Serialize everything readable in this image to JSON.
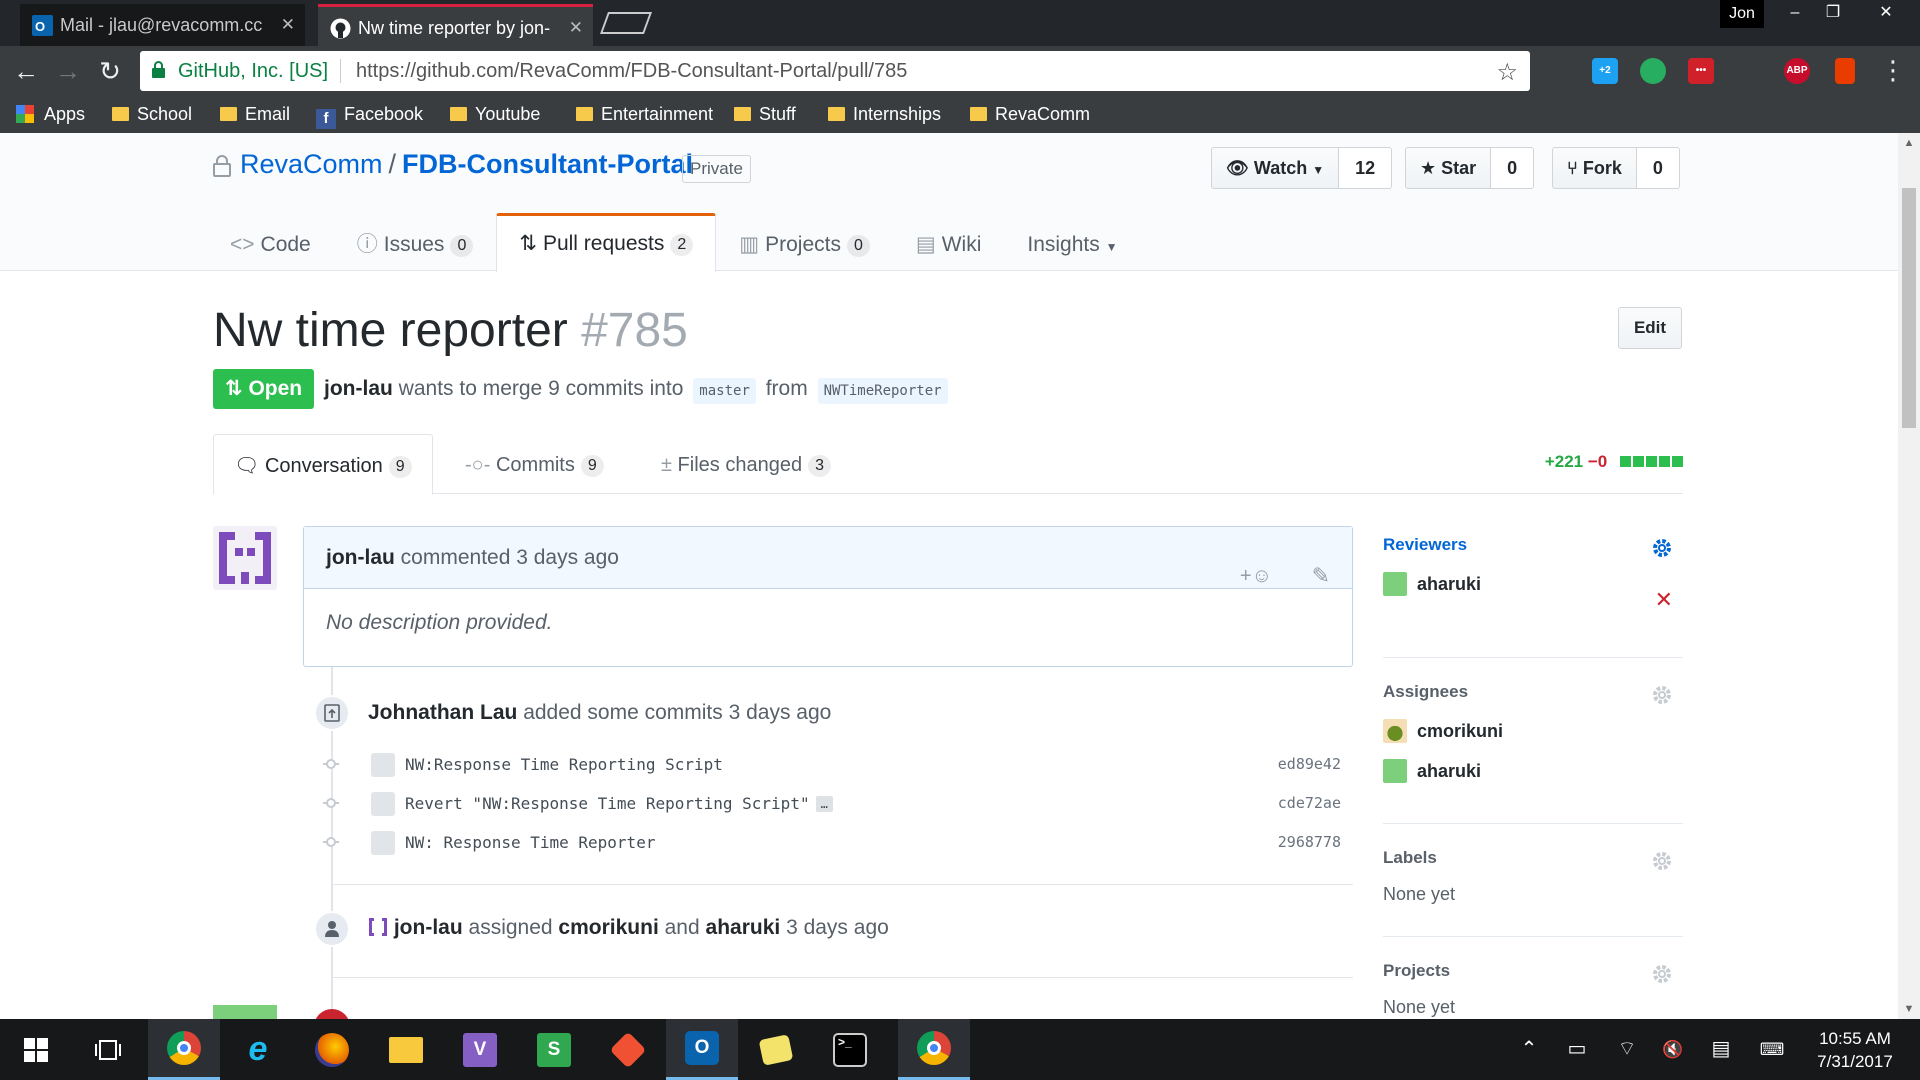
{
  "browser": {
    "tabs": [
      {
        "title": "Mail - jlau@revacomm.cc",
        "active": false
      },
      {
        "title": "Nw time reporter by jon-",
        "active": true
      }
    ],
    "user_chip": "Jon",
    "window_controls": [
      "–",
      "❐",
      "✕"
    ],
    "omnibox": {
      "security_label": "GitHub, Inc. [US]",
      "url": "https://github.com/RevaComm/FDB-Consultant-Portal/pull/785"
    },
    "extensions": [
      {
        "icon": "extension-1-icon",
        "text": "",
        "color": "#3a3d40"
      },
      {
        "icon": "extension-2-icon",
        "text": "+2",
        "color": "#1da1f2"
      },
      {
        "icon": "extension-3-icon",
        "text": "",
        "color": "#27ae60"
      },
      {
        "icon": "extension-4-icon",
        "text": "•••",
        "color": "#d0212b"
      },
      {
        "icon": "extension-5-icon",
        "text": "",
        "color": "#3a3d40"
      },
      {
        "icon": "adblock-plus-icon",
        "text": "ABP",
        "color": "#c70d2c"
      },
      {
        "icon": "office-icon",
        "text": "",
        "color": "#eb3c00"
      }
    ],
    "bookmarks": [
      {
        "label": "Apps",
        "icon": "apps-grid-icon"
      },
      {
        "label": "School",
        "icon": "folder-icon"
      },
      {
        "label": "Email",
        "icon": "folder-icon"
      },
      {
        "label": "Facebook",
        "icon": "facebook-icon"
      },
      {
        "label": "Youtube",
        "icon": "folder-icon"
      },
      {
        "label": "Entertainment",
        "icon": "folder-icon"
      },
      {
        "label": "Stuff",
        "icon": "folder-icon"
      },
      {
        "label": "Internships",
        "icon": "folder-icon"
      },
      {
        "label": "RevaComm",
        "icon": "folder-icon"
      }
    ]
  },
  "repo": {
    "owner": "RevaComm",
    "separator": "/",
    "name": "FDB-Consultant-Portal",
    "visibility": "Private",
    "actions": {
      "watch_label": "Watch",
      "watch_count": "12",
      "star_label": "Star",
      "star_count": "0",
      "fork_label": "Fork",
      "fork_count": "0"
    },
    "nav": [
      {
        "label": "Code",
        "count": "",
        "selected": false,
        "icon": "code-icon"
      },
      {
        "label": "Issues",
        "count": "0",
        "selected": false,
        "icon": "issue-icon"
      },
      {
        "label": "Pull requests",
        "count": "2",
        "selected": true,
        "icon": "pull-request-icon"
      },
      {
        "label": "Projects",
        "count": "0",
        "selected": false,
        "icon": "project-icon"
      },
      {
        "label": "Wiki",
        "count": "",
        "selected": false,
        "icon": "book-icon"
      },
      {
        "label": "Insights",
        "count": "",
        "selected": false,
        "icon": "chevron-down-icon"
      }
    ]
  },
  "pr": {
    "title": "Nw time reporter",
    "number": "#785",
    "edit_label": "Edit",
    "state": "Open",
    "author": "jon-lau",
    "merge_text": "wants to merge 9 commits into",
    "base_branch": "master",
    "from_text": "from",
    "head_branch": "NWTimeReporter",
    "tabs": [
      {
        "label": "Conversation",
        "count": "9",
        "selected": true,
        "icon": "comment-discussion-icon"
      },
      {
        "label": "Commits",
        "count": "9",
        "selected": false,
        "icon": "commit-icon"
      },
      {
        "label": "Files changed",
        "count": "3",
        "selected": false,
        "icon": "diff-icon"
      }
    ],
    "diffstat": {
      "additions": "+221",
      "deletions": "−0",
      "bars": 5
    }
  },
  "comment": {
    "author": "jon-lau",
    "action": "commented 3 days ago",
    "body": "No description provided.",
    "react_label": "+☺"
  },
  "timeline": {
    "commits_event": {
      "actor": "Johnathan Lau",
      "action": "added some commits 3 days ago"
    },
    "commits": [
      {
        "message": "NW:Response Time Reporting Script",
        "sha": "ed89e42",
        "has_more": false
      },
      {
        "message": "Revert \"NW:Response Time Reporting Script\"",
        "sha": "cde72ae",
        "has_more": true
      },
      {
        "message": "NW: Response Time Reporter",
        "sha": "2968778",
        "has_more": false
      }
    ],
    "ellipsis_label": "…",
    "assign_event": {
      "actor": "jon-lau",
      "verb": "assigned",
      "user1": "cmorikuni",
      "conj": "and",
      "user2": "aharuki",
      "time": "3 days ago"
    }
  },
  "sidebar": {
    "reviewers": {
      "heading": "Reviewers",
      "items": [
        "aharuki"
      ]
    },
    "assignees": {
      "heading": "Assignees",
      "items": [
        "cmorikuni",
        "aharuki"
      ]
    },
    "labels": {
      "heading": "Labels",
      "empty": "None yet"
    },
    "projects": {
      "heading": "Projects",
      "empty": "None yet"
    }
  },
  "taskbar": {
    "apps": [
      {
        "icon": "windows-start-icon",
        "running": false
      },
      {
        "icon": "task-view-icon",
        "running": false
      },
      {
        "icon": "chrome-icon",
        "running": true
      },
      {
        "icon": "internet-explorer-icon",
        "running": false
      },
      {
        "icon": "firefox-icon",
        "running": false
      },
      {
        "icon": "file-explorer-icon",
        "running": false
      },
      {
        "icon": "visual-studio-icon",
        "running": false
      },
      {
        "icon": "sourcetree-icon",
        "running": false
      },
      {
        "icon": "git-icon",
        "running": false
      },
      {
        "icon": "outlook-icon",
        "running": true
      },
      {
        "icon": "sticky-notes-icon",
        "running": false
      },
      {
        "icon": "terminal-icon",
        "running": false
      },
      {
        "icon": "chrome-profile-icon",
        "running": true
      }
    ],
    "time": "10:55 AM",
    "date": "7/31/2017"
  },
  "colors": {
    "link": "#0366d6",
    "open_green": "#2cbe4e",
    "tab_underline": "#e36209",
    "deletion_red": "#cb2431"
  }
}
